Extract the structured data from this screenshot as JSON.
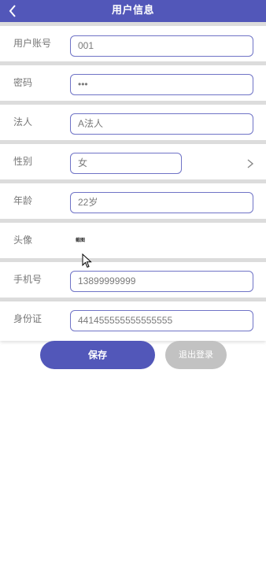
{
  "header": {
    "title": "用户信息",
    "back_icon": "chevron-left-icon"
  },
  "form": {
    "username": {
      "label": "用户账号",
      "value": "001"
    },
    "password": {
      "label": "密码",
      "value": "•••"
    },
    "legal_person": {
      "label": "法人",
      "value": "A法人"
    },
    "gender": {
      "label": "性别",
      "value": "女",
      "icon": "chevron-right-icon"
    },
    "age": {
      "label": "年龄",
      "value": "22岁"
    },
    "avatar": {
      "label": "头像",
      "value": "截图"
    },
    "phone": {
      "label": "手机号",
      "value": "13899999999"
    },
    "id_card": {
      "label": "身份证",
      "value": "441455555555555555"
    }
  },
  "actions": {
    "save_label": "保存",
    "logout_label": "退出登录"
  },
  "colors": {
    "primary": "#5257b9",
    "separator": "#dcdcdc",
    "logout": "#c2c2c2",
    "field_border": "#6f73c6"
  }
}
